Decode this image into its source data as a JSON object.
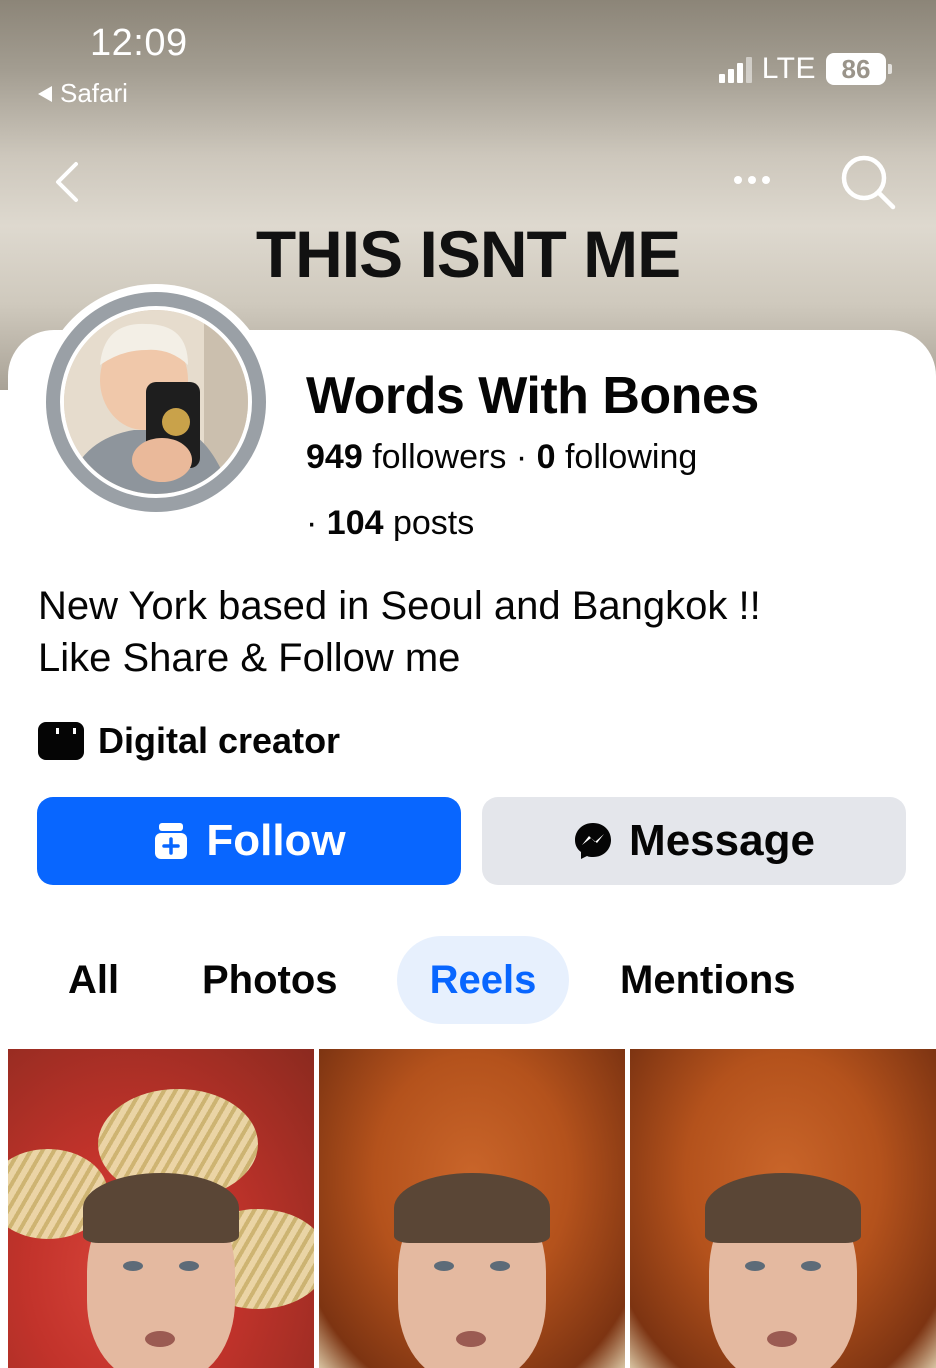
{
  "status_bar": {
    "time": "12:09",
    "back_app": "Safari",
    "network": "LTE",
    "battery": "86"
  },
  "overlay_title": "THIS ISNT ME",
  "profile": {
    "name": "Words With Bones",
    "followers_count": "949",
    "followers_label": "followers",
    "separator": "·",
    "following_count": "0",
    "following_label": "following",
    "posts_count": "104",
    "posts_label": "posts",
    "bio_line1": "New York based in Seoul and Bangkok !!",
    "bio_line2": "Like Share & Follow me",
    "category": "Digital creator"
  },
  "actions": {
    "follow_label": "Follow",
    "message_label": "Message"
  },
  "tabs": [
    {
      "label": "All",
      "active": false
    },
    {
      "label": "Photos",
      "active": false
    },
    {
      "label": "Reels",
      "active": true
    },
    {
      "label": "Mentions",
      "active": false
    }
  ],
  "colors": {
    "primary": "#0866ff",
    "secondary_button": "#e4e6eb",
    "active_tab_bg": "#e7f0fd"
  }
}
